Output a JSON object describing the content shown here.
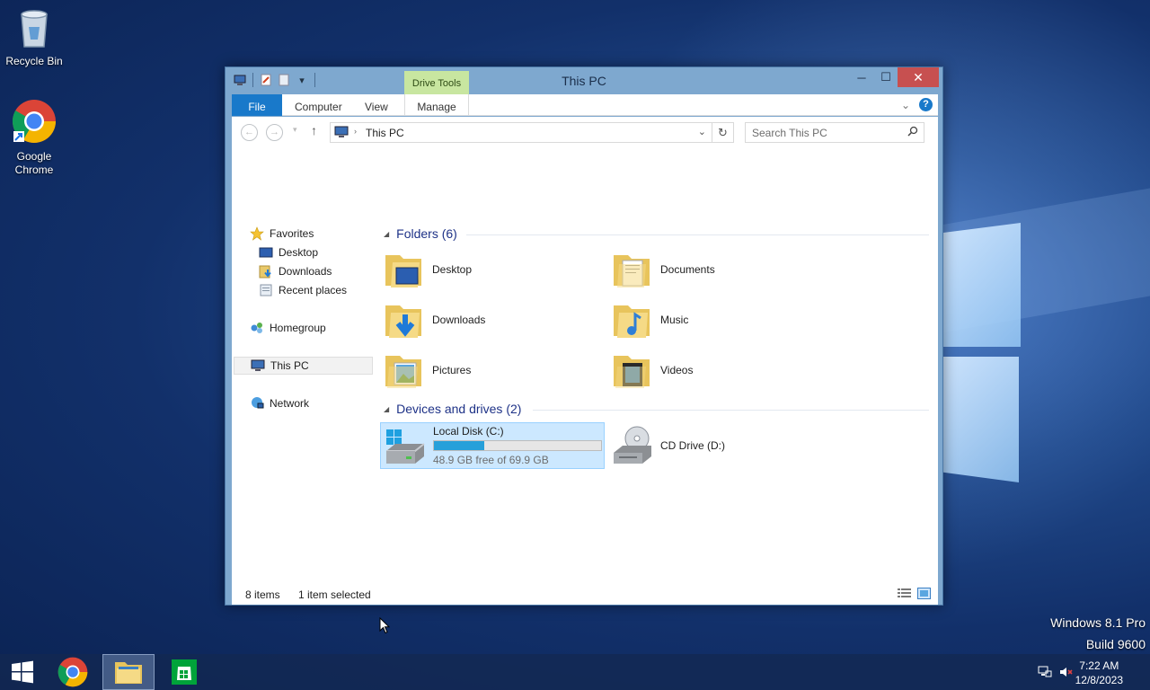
{
  "desktop": {
    "icons": [
      {
        "label": "Recycle Bin",
        "icon": "recycle-bin-icon"
      },
      {
        "label": "Google\nChrome",
        "icon": "chrome-icon"
      }
    ],
    "watermark": {
      "edition": "Windows 8.1 Pro",
      "build": "Build 9600"
    }
  },
  "window": {
    "title": "This PC",
    "contextual_tab_group": "Drive Tools",
    "ribbon_tabs": [
      "File",
      "Computer",
      "View",
      "Manage"
    ],
    "address": "This PC",
    "search_placeholder": "Search This PC",
    "controls": {
      "minimize": "─",
      "maximize": "☐",
      "close": "✕"
    }
  },
  "navpane": {
    "favorites": "Favorites",
    "favorites_items": [
      "Desktop",
      "Downloads",
      "Recent places"
    ],
    "homegroup": "Homegroup",
    "this_pc": "This PC",
    "network": "Network"
  },
  "main": {
    "folders_header": "Folders (6)",
    "folders": [
      {
        "label": "Desktop",
        "icon": "desktop-folder-icon"
      },
      {
        "label": "Documents",
        "icon": "documents-folder-icon"
      },
      {
        "label": "Downloads",
        "icon": "downloads-folder-icon"
      },
      {
        "label": "Music",
        "icon": "music-folder-icon"
      },
      {
        "label": "Pictures",
        "icon": "pictures-folder-icon"
      },
      {
        "label": "Videos",
        "icon": "videos-folder-icon"
      }
    ],
    "devices_header": "Devices and drives (2)",
    "drives": [
      {
        "label": "Local Disk (C:)",
        "free_text": "48.9 GB free of 69.9 GB",
        "used_fraction": 0.3,
        "selected": true
      },
      {
        "label": "CD Drive (D:)"
      }
    ]
  },
  "status": {
    "items": "8 items",
    "selected": "1 item selected"
  },
  "taskbar": {
    "time": "7:22 AM",
    "date": "12/8/2023",
    "apps": [
      "start-button",
      "chrome",
      "file-explorer",
      "store"
    ]
  },
  "colors": {
    "accent": "#1979ca",
    "selection": "#cce8ff",
    "bar_fill": "#26a0da"
  }
}
